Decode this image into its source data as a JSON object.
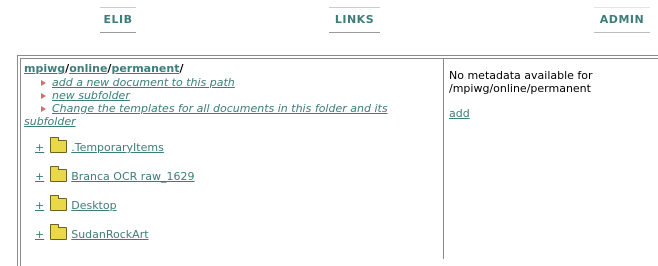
{
  "nav": {
    "elib": "ELIB",
    "links": "LINKS",
    "admin": "ADMIN"
  },
  "breadcrumb": {
    "parts": [
      "mpiwg",
      "online",
      "permanent"
    ],
    "separator": "/"
  },
  "actions": [
    "add a new document to this path",
    "new subfolder",
    "Change the templates for all documents in this folder and its",
    "subfolder"
  ],
  "folders": [
    {
      "expand": "+",
      "name": ".TemporaryItems"
    },
    {
      "expand": "+",
      "name": "Branca OCR raw_1629"
    },
    {
      "expand": "+",
      "name": "Desktop"
    },
    {
      "expand": "+",
      "name": "SudanRockArt"
    }
  ],
  "metadata": {
    "message_line1": "No metadata available for",
    "message_line2": "/mpiwg/online/permanent",
    "add_link": "add"
  },
  "colors": {
    "link": "#3d7d7a",
    "bullet": "#c97070",
    "folder": "#e8d84a"
  }
}
